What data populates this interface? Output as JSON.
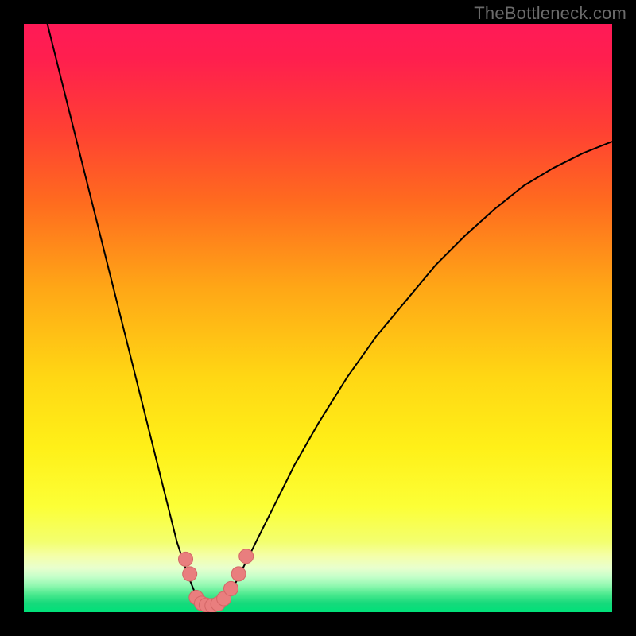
{
  "watermark": "TheBottleneck.com",
  "colors": {
    "frame": "#000000",
    "curve_stroke": "#000000",
    "marker_fill": "#e97e7e",
    "marker_stroke": "#d46666",
    "gradient_stops": [
      {
        "offset": 0.0,
        "color": "#ff1a57"
      },
      {
        "offset": 0.06,
        "color": "#ff1f4e"
      },
      {
        "offset": 0.18,
        "color": "#ff4033"
      },
      {
        "offset": 0.3,
        "color": "#ff6a1f"
      },
      {
        "offset": 0.45,
        "color": "#ffa716"
      },
      {
        "offset": 0.6,
        "color": "#ffd714"
      },
      {
        "offset": 0.72,
        "color": "#fff018"
      },
      {
        "offset": 0.82,
        "color": "#fcff36"
      },
      {
        "offset": 0.88,
        "color": "#f3ff6e"
      },
      {
        "offset": 0.905,
        "color": "#f4ffaa"
      },
      {
        "offset": 0.925,
        "color": "#e8ffce"
      },
      {
        "offset": 0.94,
        "color": "#c4ffc9"
      },
      {
        "offset": 0.955,
        "color": "#90f8b0"
      },
      {
        "offset": 0.97,
        "color": "#4ae98e"
      },
      {
        "offset": 0.985,
        "color": "#16d97b"
      },
      {
        "offset": 1.0,
        "color": "#00e17a"
      }
    ]
  },
  "chart_data": {
    "type": "line",
    "title": "",
    "xlabel": "",
    "ylabel": "",
    "xlim": [
      0,
      100
    ],
    "ylim": [
      0,
      100
    ],
    "series": [
      {
        "name": "bottleneck-curve",
        "x": [
          4,
          6,
          8,
          10,
          12,
          14,
          16,
          18,
          20,
          22,
          24,
          25,
          26,
          27,
          28,
          29,
          30,
          31,
          32,
          33,
          34,
          36,
          38,
          40,
          43,
          46,
          50,
          55,
          60,
          65,
          70,
          75,
          80,
          85,
          90,
          95,
          100
        ],
        "y": [
          100,
          92,
          84,
          76,
          68,
          60,
          52,
          44,
          36,
          28,
          20,
          16,
          12,
          9,
          6,
          3.5,
          2,
          1.2,
          1,
          1.3,
          2.2,
          5,
          9,
          13,
          19,
          25,
          32,
          40,
          47,
          53,
          59,
          64,
          68.5,
          72.5,
          75.5,
          78,
          80
        ]
      }
    ],
    "markers": {
      "name": "highlighted-points",
      "points": [
        {
          "x": 27.5,
          "y": 9
        },
        {
          "x": 28.2,
          "y": 6.5
        },
        {
          "x": 29.3,
          "y": 2.5
        },
        {
          "x": 30.2,
          "y": 1.5
        },
        {
          "x": 31.0,
          "y": 1.2
        },
        {
          "x": 32.0,
          "y": 1.1
        },
        {
          "x": 33.0,
          "y": 1.4
        },
        {
          "x": 34.0,
          "y": 2.3
        },
        {
          "x": 35.2,
          "y": 4.0
        },
        {
          "x": 36.5,
          "y": 6.5
        },
        {
          "x": 37.8,
          "y": 9.5
        }
      ]
    }
  }
}
